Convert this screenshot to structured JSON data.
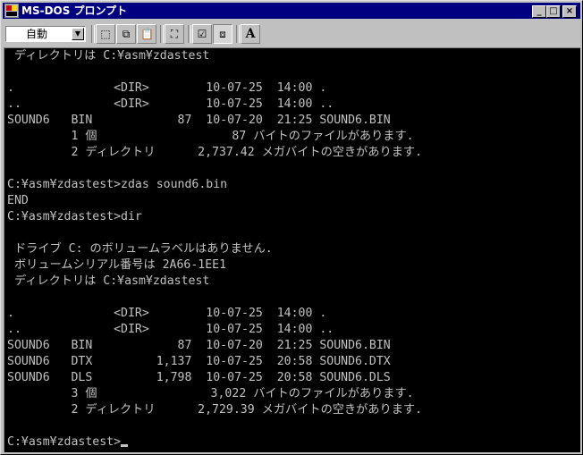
{
  "window": {
    "title": "MS-DOS プロンプト"
  },
  "title_buttons": {
    "minimize": "_",
    "maximize": "□",
    "close": "×"
  },
  "toolbar": {
    "font_size": "自動",
    "dropdown_arrow": "▼",
    "tools": [
      {
        "icon": "mark-icon",
        "glyph": "⬚"
      },
      {
        "icon": "copy-icon",
        "glyph": "⧉"
      },
      {
        "icon": "paste-icon",
        "glyph": "📋"
      },
      {
        "icon": "fullscreen-icon",
        "glyph": "⛶"
      },
      {
        "icon": "properties-icon",
        "glyph": "☑"
      },
      {
        "icon": "background-icon",
        "glyph": "⧈"
      },
      {
        "icon": "font-icon",
        "glyph": "A"
      }
    ]
  },
  "console": {
    "lines": [
      " ディレクトリは C:¥asm¥zdastest",
      "",
      ".              <DIR>        10-07-25  14:00 .",
      "..             <DIR>        10-07-25  14:00 ..",
      "SOUND6   BIN            87  10-07-20  21:25 SOUND6.BIN",
      "         1 個                   87 バイトのファイルがあります.",
      "         2 ディレクトリ      2,737.42 メガバイトの空きがあります.",
      "",
      "C:¥asm¥zdastest>zdas sound6.bin",
      "END",
      "C:¥asm¥zdastest>dir",
      "",
      " ドライブ C: のボリュームラベルはありません.",
      " ボリュームシリアル番号は 2A66-1EE1",
      " ディレクトリは C:¥asm¥zdastest",
      "",
      ".              <DIR>        10-07-25  14:00 .",
      "..             <DIR>        10-07-25  14:00 ..",
      "SOUND6   BIN            87  10-07-20  21:25 SOUND6.BIN",
      "SOUND6   DTX         1,137  10-07-25  20:58 SOUND6.DTX",
      "SOUND6   DLS         1,798  10-07-25  20:58 SOUND6.DLS",
      "         3 個                3,022 バイトのファイルがあります.",
      "         2 ディレクトリ      2,729.39 メガバイトの空きがあります.",
      "",
      "C:¥asm¥zdastest>"
    ]
  },
  "colors": {
    "titlebar": "#000080",
    "console_bg": "#000000",
    "console_text": "#c0c0c0",
    "chrome": "#c0c0c0"
  }
}
